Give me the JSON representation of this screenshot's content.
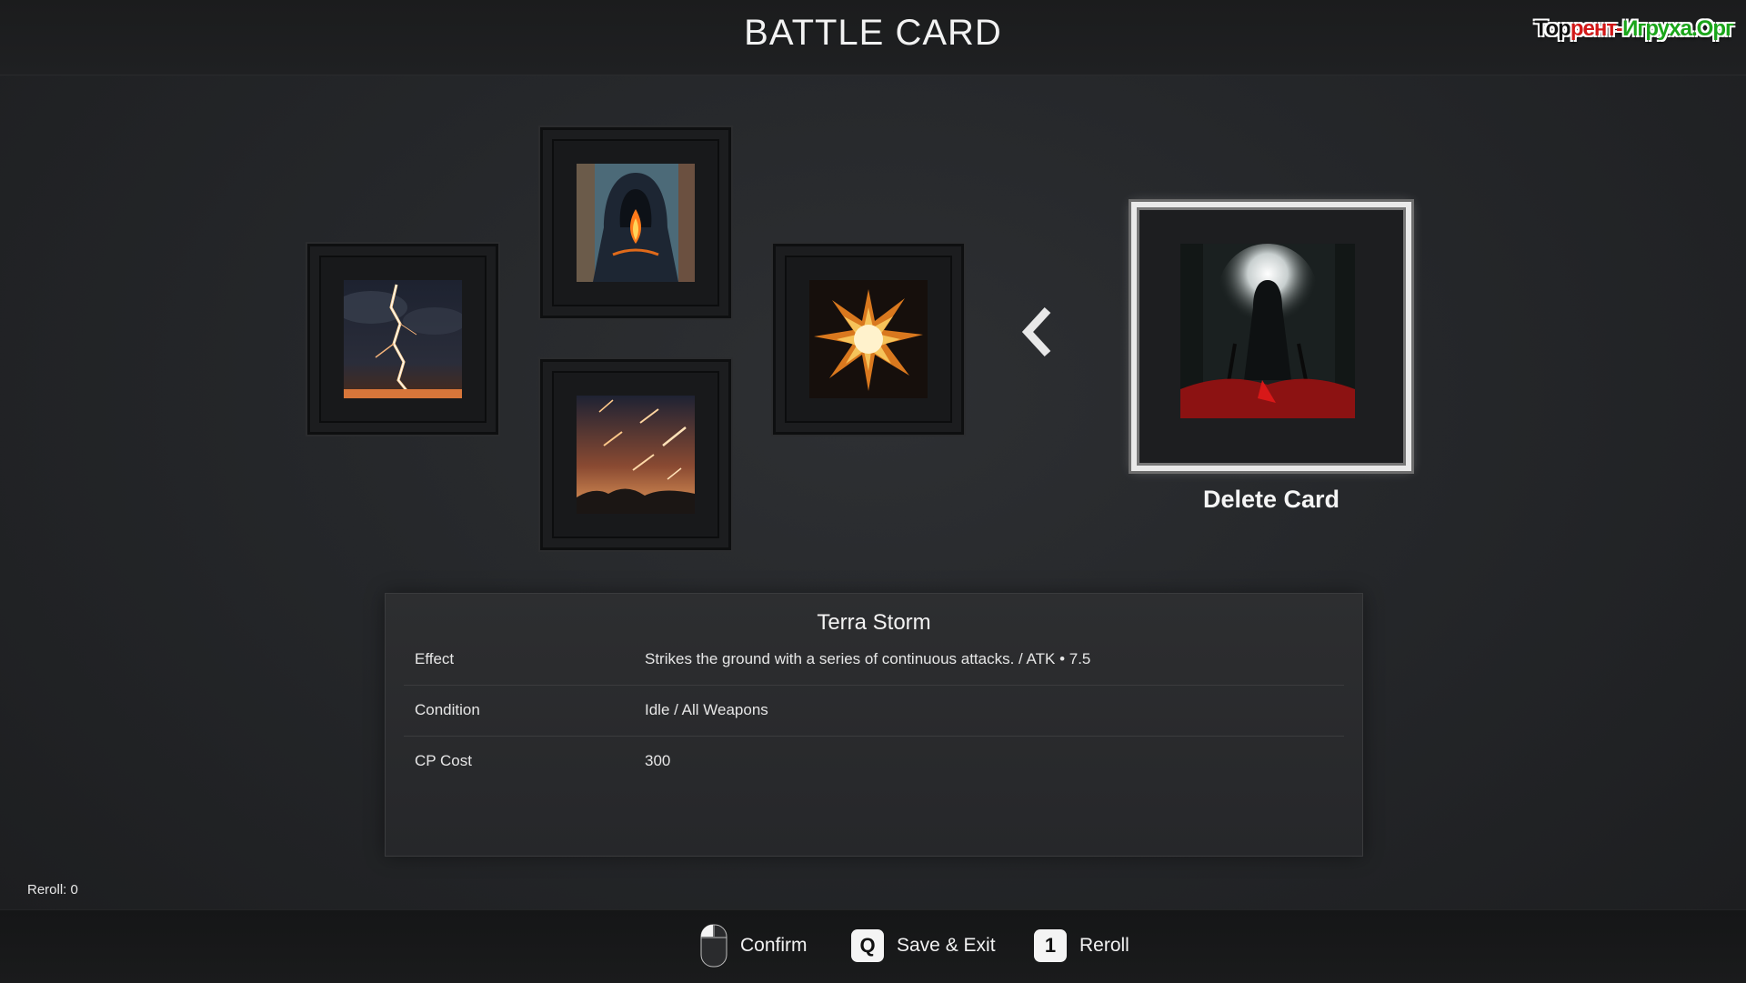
{
  "header": {
    "title": "BATTLE CARD"
  },
  "watermark": {
    "part1": "Тор",
    "part2": "рент-",
    "part3": "Игруха.Орг"
  },
  "cards": [
    {
      "name": "lightning-card",
      "icon": "lightning-icon"
    },
    {
      "name": "hooded-flame-card",
      "icon": "hooded-figure-icon"
    },
    {
      "name": "meteor-card",
      "icon": "meteor-shower-icon"
    },
    {
      "name": "explosion-card",
      "icon": "explosion-icon"
    }
  ],
  "delete": {
    "label": "Delete Card",
    "icon": "dark-knight-icon"
  },
  "info": {
    "title": "Terra Storm",
    "rows": [
      {
        "key": "Effect",
        "value": "Strikes the ground with a series of continuous attacks. / ATK • 7.5"
      },
      {
        "key": "Condition",
        "value": "Idle / All Weapons"
      },
      {
        "key": "CP Cost",
        "value": "300"
      }
    ]
  },
  "status": {
    "reroll": "Reroll: 0"
  },
  "footer": {
    "confirm": {
      "label": "Confirm",
      "icon": "mouse-left-click-icon"
    },
    "save_exit": {
      "key": "Q",
      "label": "Save & Exit"
    },
    "reroll": {
      "key": "1",
      "label": "Reroll"
    }
  }
}
